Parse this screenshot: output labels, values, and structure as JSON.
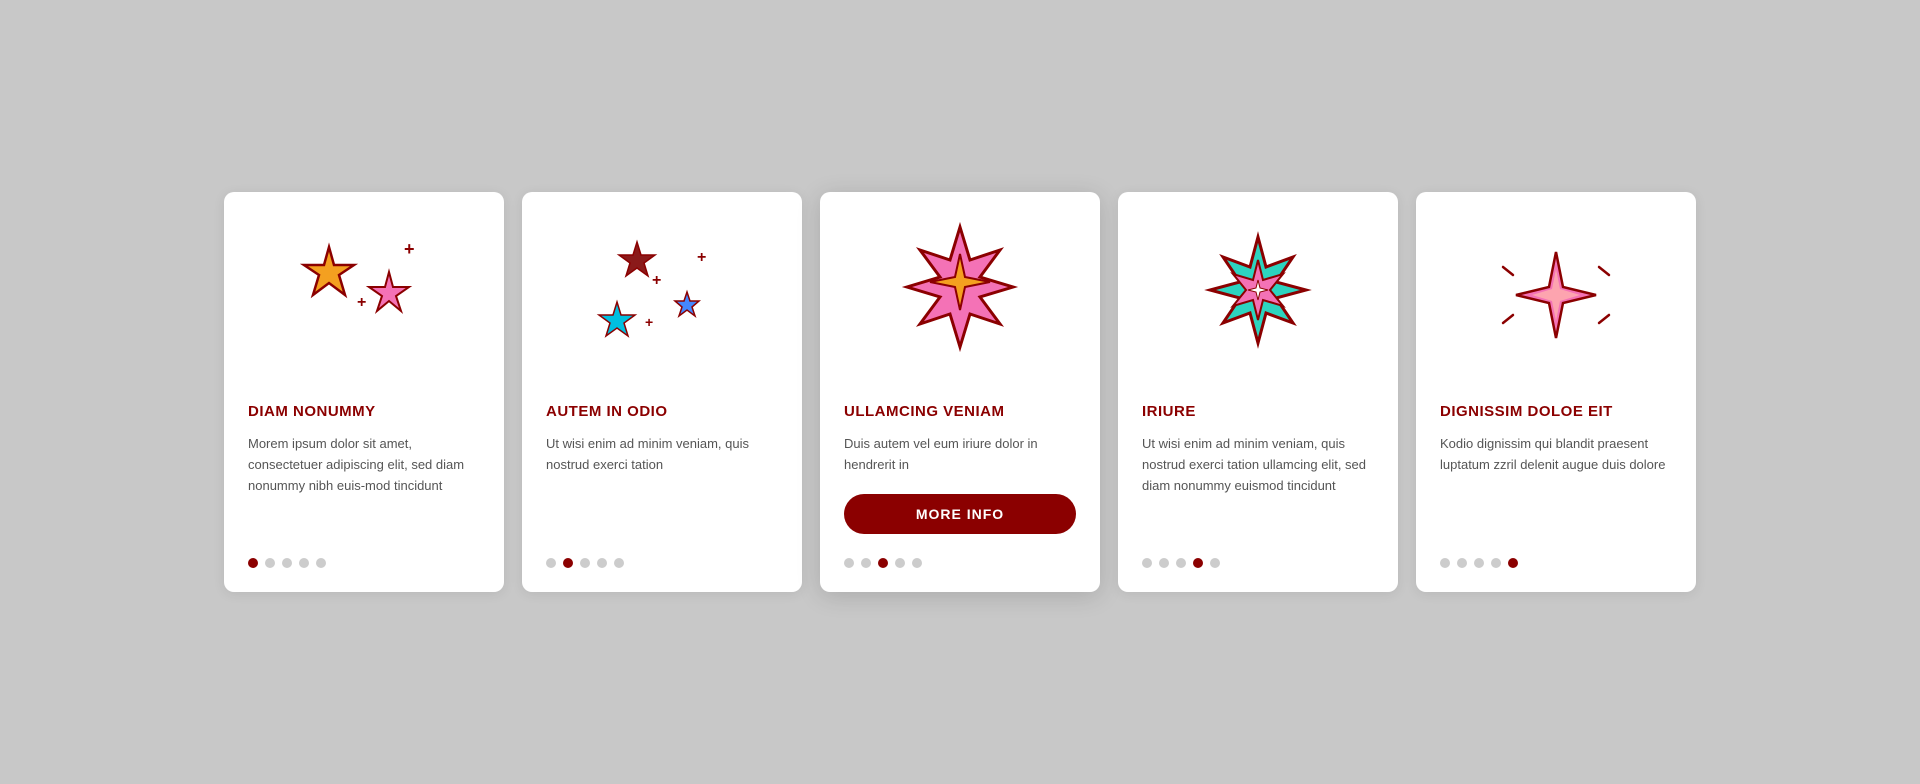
{
  "cards": [
    {
      "id": "card-1",
      "title": "DIAM NONUMMY",
      "text": "Morem ipsum dolor sit amet, consectetuer adipiscing elit, sed diam nonummy nibh euis-mod tincidunt",
      "active_dot": 0,
      "has_button": false,
      "icon": "sparkles-orange-pink"
    },
    {
      "id": "card-2",
      "title": "AUTEM IN ODIO",
      "text": "Ut wisi enim ad minim veniam, quis nostrud exerci tation",
      "active_dot": 1,
      "has_button": false,
      "icon": "stars-cyan-dark"
    },
    {
      "id": "card-3",
      "title": "ULLAMCING VENIAM",
      "text": "Duis autem vel eum iriure dolor in hendrerit in",
      "active_dot": 2,
      "has_button": true,
      "button_label": "MORE INFO",
      "icon": "star-pink-orange"
    },
    {
      "id": "card-4",
      "title": "IRIURE",
      "text": "Ut wisi enim ad minim veniam, quis nostrud exerci tation ullamcing elit, sed diam nonummy euismod tincidunt",
      "active_dot": 3,
      "has_button": false,
      "icon": "star-teal-pink"
    },
    {
      "id": "card-5",
      "title": "DIGNISSIM DOLOE EIT",
      "text": "Kodio dignissim qui blandit praesent luptatum zzril delenit augue duis dolore",
      "active_dot": 4,
      "has_button": false,
      "icon": "sparkle-pink"
    }
  ],
  "dots_count": 5
}
